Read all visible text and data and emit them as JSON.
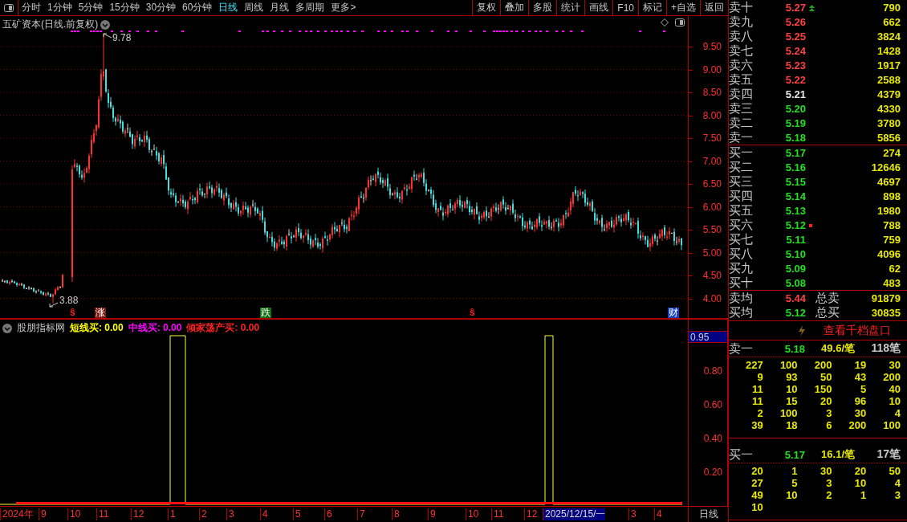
{
  "toolbar": {
    "periods": [
      {
        "label": "分时",
        "selected": false
      },
      {
        "label": "1分钟",
        "selected": false
      },
      {
        "label": "5分钟",
        "selected": false
      },
      {
        "label": "15分钟",
        "selected": false
      },
      {
        "label": "30分钟",
        "selected": false
      },
      {
        "label": "60分钟",
        "selected": false
      },
      {
        "label": "日线",
        "selected": true
      },
      {
        "label": "周线",
        "selected": false
      },
      {
        "label": "月线",
        "selected": false
      },
      {
        "label": "多周期",
        "selected": false
      },
      {
        "label": "更多>",
        "selected": false
      }
    ],
    "buttons": [
      "复权",
      "叠加",
      "多股",
      "统计",
      "画线",
      "F10",
      "标记",
      "+自选",
      "返回"
    ]
  },
  "chart": {
    "title": "五矿资本(日线.前复权)",
    "high_label": "9.78",
    "low_label": "3.88",
    "price_axis": [
      "9.50",
      "9.00",
      "8.50",
      "8.00",
      "7.50",
      "7.00",
      "6.50",
      "6.00",
      "5.50",
      "5.00",
      "4.50",
      "4.00"
    ],
    "events": [
      {
        "text": "ŝ",
        "kind": "signal"
      },
      {
        "text": "涨",
        "kind": "up"
      },
      {
        "text": "跌",
        "kind": "down"
      },
      {
        "text": "ŝ",
        "kind": "signal"
      },
      {
        "text": "财",
        "kind": "finance"
      }
    ]
  },
  "indicator": {
    "name": "股朋指标网",
    "lines": [
      {
        "label": "短线买: 0.00",
        "color": "#ffff00"
      },
      {
        "label": "中线买: 0.00",
        "color": "#ff00ff"
      },
      {
        "label": "倾家荡产买: 0.00",
        "color": "#ff2020"
      }
    ],
    "current": "0.95",
    "axis": [
      "0.80",
      "0.60",
      "0.40",
      "0.20"
    ]
  },
  "time_axis": {
    "labels": [
      {
        "label": "2024年",
        "highlighted": false
      },
      {
        "label": "9",
        "highlighted": false
      },
      {
        "label": "10",
        "highlighted": false
      },
      {
        "label": "11",
        "highlighted": false
      },
      {
        "label": "12",
        "highlighted": false
      },
      {
        "label": "1",
        "highlighted": false
      },
      {
        "label": "2",
        "highlighted": false
      },
      {
        "label": "3",
        "highlighted": false
      },
      {
        "label": "4",
        "highlighted": false
      },
      {
        "label": "5",
        "highlighted": false
      },
      {
        "label": "6",
        "highlighted": false
      },
      {
        "label": "7",
        "highlighted": false
      },
      {
        "label": "8",
        "highlighted": false
      },
      {
        "label": "9",
        "highlighted": false
      },
      {
        "label": "10",
        "highlighted": false
      },
      {
        "label": "11",
        "highlighted": false
      },
      {
        "label": "12",
        "highlighted": false
      },
      {
        "label": "2025/12/15/一",
        "highlighted": true
      },
      {
        "label": "3",
        "highlighted": false
      },
      {
        "label": "4",
        "highlighted": false
      }
    ],
    "period": "日线"
  },
  "book": {
    "asks": [
      {
        "label": "卖十",
        "price": "5.27",
        "color": "#ff4040",
        "volume": "790",
        "kind": "arrow"
      },
      {
        "label": "卖九",
        "price": "5.26",
        "color": "#ff4040",
        "volume": "662",
        "kind": "plain"
      },
      {
        "label": "卖八",
        "price": "5.25",
        "color": "#ff4040",
        "volume": "3824",
        "kind": "plain"
      },
      {
        "label": "卖七",
        "price": "5.24",
        "color": "#ff4040",
        "volume": "1428",
        "kind": "plain"
      },
      {
        "label": "卖六",
        "price": "5.23",
        "color": "#ff4040",
        "volume": "1917",
        "kind": "plain"
      },
      {
        "label": "卖五",
        "price": "5.22",
        "color": "#ff4040",
        "volume": "2588",
        "kind": "plain"
      },
      {
        "label": "卖四",
        "price": "5.21",
        "color": "#e8e8e8",
        "volume": "4379",
        "kind": "plain"
      },
      {
        "label": "卖三",
        "price": "5.20",
        "color": "#20e020",
        "volume": "4330",
        "kind": "plain"
      },
      {
        "label": "卖二",
        "price": "5.19",
        "color": "#20e020",
        "volume": "3780",
        "kind": "plain"
      },
      {
        "label": "卖一",
        "price": "5.18",
        "color": "#20e020",
        "volume": "5856",
        "kind": "plain"
      }
    ],
    "bids": [
      {
        "label": "买一",
        "price": "5.17",
        "color": "#20e020",
        "volume": "274",
        "kind": "plain"
      },
      {
        "label": "买二",
        "price": "5.16",
        "color": "#20e020",
        "volume": "12646",
        "kind": "plain"
      },
      {
        "label": "买三",
        "price": "5.15",
        "color": "#20e020",
        "volume": "4697",
        "kind": "plain"
      },
      {
        "label": "买四",
        "price": "5.14",
        "color": "#20e020",
        "volume": "898",
        "kind": "plain"
      },
      {
        "label": "买五",
        "price": "5.13",
        "color": "#20e020",
        "volume": "1980",
        "kind": "plain"
      },
      {
        "label": "买六",
        "price": "5.12",
        "color": "#20e020",
        "volume": "788",
        "kind": "square"
      },
      {
        "label": "买七",
        "price": "5.11",
        "color": "#20e020",
        "volume": "759",
        "kind": "plain"
      },
      {
        "label": "买八",
        "price": "5.10",
        "color": "#20e020",
        "volume": "4096",
        "kind": "plain"
      },
      {
        "label": "买九",
        "price": "5.09",
        "color": "#20e020",
        "volume": "62",
        "kind": "plain"
      },
      {
        "label": "买十",
        "price": "5.08",
        "color": "#20e020",
        "volume": "483",
        "kind": "plain"
      }
    ],
    "summary": [
      {
        "label": "卖均",
        "price": "5.44",
        "color": "#ff4040",
        "total_label": "总卖",
        "total": "91879"
      },
      {
        "label": "买均",
        "price": "5.12",
        "color": "#20e020",
        "total_label": "总买",
        "total": "30835"
      }
    ],
    "depth_link": "查看千档盘口",
    "queues": [
      {
        "label": "卖一",
        "price": "5.18",
        "avg": "49.6/笔",
        "count": "118笔",
        "rows": [
          [
            "227",
            "100",
            "200",
            "19",
            "30"
          ],
          [
            "9",
            "93",
            "50",
            "43",
            "200"
          ],
          [
            "11",
            "10",
            "150",
            "5",
            "40"
          ],
          [
            "11",
            "15",
            "20",
            "96",
            "10"
          ],
          [
            "2",
            "100",
            "3",
            "30",
            "4"
          ],
          [
            "39",
            "18",
            "6",
            "200",
            "100"
          ]
        ]
      },
      {
        "label": "买一",
        "price": "5.17",
        "avg": "16.1/笔",
        "count": "17笔",
        "rows": [
          [
            "20",
            "1",
            "30",
            "20",
            "50"
          ],
          [
            "27",
            "5",
            "3",
            "10",
            "4"
          ],
          [
            "49",
            "10",
            "2",
            "1",
            "3"
          ],
          [
            "10"
          ]
        ]
      }
    ]
  }
}
